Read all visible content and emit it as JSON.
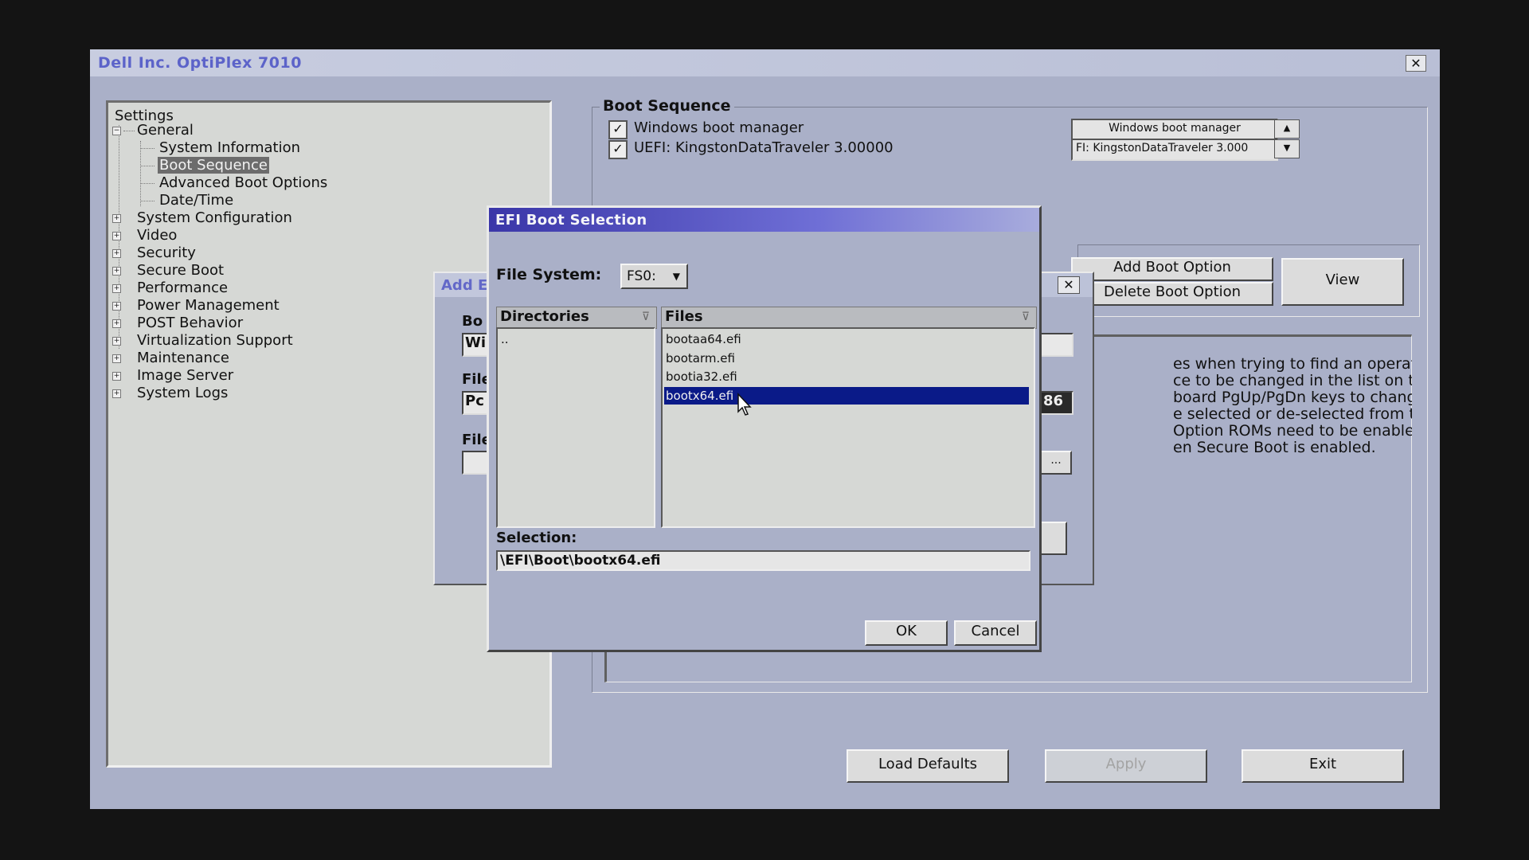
{
  "window": {
    "title": "Dell Inc. OptiPlex 7010",
    "close_glyph": "✕"
  },
  "tree": {
    "root": "Settings",
    "items": [
      {
        "label": "General",
        "level": 1,
        "expanded": true
      },
      {
        "label": "System Information",
        "level": 2
      },
      {
        "label": "Boot Sequence",
        "level": 2,
        "selected": true
      },
      {
        "label": "Advanced Boot Options",
        "level": 2
      },
      {
        "label": "Date/Time",
        "level": 2
      },
      {
        "label": "System Configuration",
        "level": 1
      },
      {
        "label": "Video",
        "level": 1
      },
      {
        "label": "Security",
        "level": 1
      },
      {
        "label": "Secure Boot",
        "level": 1
      },
      {
        "label": "Performance",
        "level": 1
      },
      {
        "label": "Power Management",
        "level": 1
      },
      {
        "label": "POST Behavior",
        "level": 1
      },
      {
        "label": "Virtualization Support",
        "level": 1
      },
      {
        "label": "Maintenance",
        "level": 1
      },
      {
        "label": "Image Server",
        "level": 1
      },
      {
        "label": "System Logs",
        "level": 1
      }
    ]
  },
  "boot_sequence": {
    "legend": "Boot Sequence",
    "items": [
      {
        "label": "Windows boot manager",
        "checked": true
      },
      {
        "label": "UEFI: KingstonDataTraveler 3.00000",
        "checked": true
      }
    ],
    "order": [
      "Windows boot manager",
      "FI: KingstonDataTraveler 3.000"
    ],
    "add_button": "Add Boot Option",
    "delete_button": "Delete Boot Option",
    "view_button": "View",
    "description_lines": [
      "es when trying to find an operating",
      "ce to be changed in the list on the",
      "board PgUp/PgDn keys to change",
      "e selected or de-selected from the",
      "Option ROMs need to be enabled for",
      "en Secure Boot is enabled."
    ]
  },
  "add_dialog": {
    "title": "Add E",
    "labels": [
      "Bo",
      "File",
      "File"
    ],
    "values": [
      "Wi",
      "Pc",
      ""
    ],
    "right_values": [
      "",
      "86",
      "..."
    ]
  },
  "efi_dialog": {
    "title": "EFI Boot Selection",
    "file_system_label": "File System:",
    "file_system_value": "FS0:",
    "directories_header": "Directories",
    "directories": [
      ".."
    ],
    "files_header": "Files",
    "files": [
      "bootaa64.efi",
      "bootarm.efi",
      "bootia32.efi",
      "bootx64.efi"
    ],
    "selected_file_index": 3,
    "selection_label": "Selection:",
    "selection_value": "\\EFI\\Boot\\bootx64.efi",
    "ok_button": "OK",
    "cancel_button": "Cancel"
  },
  "footer": {
    "load_defaults": "Load Defaults",
    "apply": "Apply",
    "exit": "Exit"
  },
  "colors": {
    "window_bg": "#aab0c8",
    "title_gradient_start": "#3a36a8",
    "selection_bg": "#0a1a88",
    "tree_selected_bg": "#6c6c6c"
  }
}
